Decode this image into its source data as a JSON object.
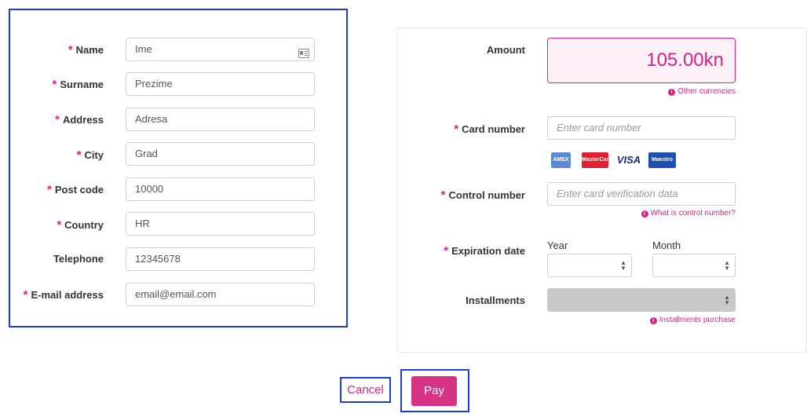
{
  "personal_form": {
    "fields": [
      {
        "label": "Name",
        "required": true,
        "value": "Ime"
      },
      {
        "label": "Surname",
        "required": true,
        "value": "Prezime"
      },
      {
        "label": "Address",
        "required": true,
        "value": "Adresa"
      },
      {
        "label": "City",
        "required": true,
        "value": "Grad"
      },
      {
        "label": "Post code",
        "required": true,
        "value": "10000"
      },
      {
        "label": "Country",
        "required": true,
        "value": "HR"
      },
      {
        "label": "Telephone",
        "required": false,
        "value": "12345678"
      },
      {
        "label": "E-mail address",
        "required": true,
        "value": "email@email.com"
      }
    ],
    "required_mark": "*"
  },
  "payment": {
    "amount_label": "Amount",
    "amount_value": "105.00kn",
    "other_currencies": "Other currencies",
    "card_number_label": "Card number",
    "card_number_placeholder": "Enter card number",
    "cards": [
      "AMEX",
      "MasterCard",
      "VISA",
      "Maestro"
    ],
    "control_number_label": "Control number",
    "control_number_placeholder": "Enter card verification data",
    "control_number_help": "What is control number?",
    "expiration_label": "Expiration date",
    "year_label": "Year",
    "month_label": "Month",
    "installments_label": "Installments",
    "installments_help": "Installments purchase",
    "info_glyph": "i"
  },
  "actions": {
    "cancel_label": "Cancel",
    "pay_label": "Pay"
  },
  "colors": {
    "accent": "#d63384",
    "highlight_outline": "#1a3fd6"
  }
}
